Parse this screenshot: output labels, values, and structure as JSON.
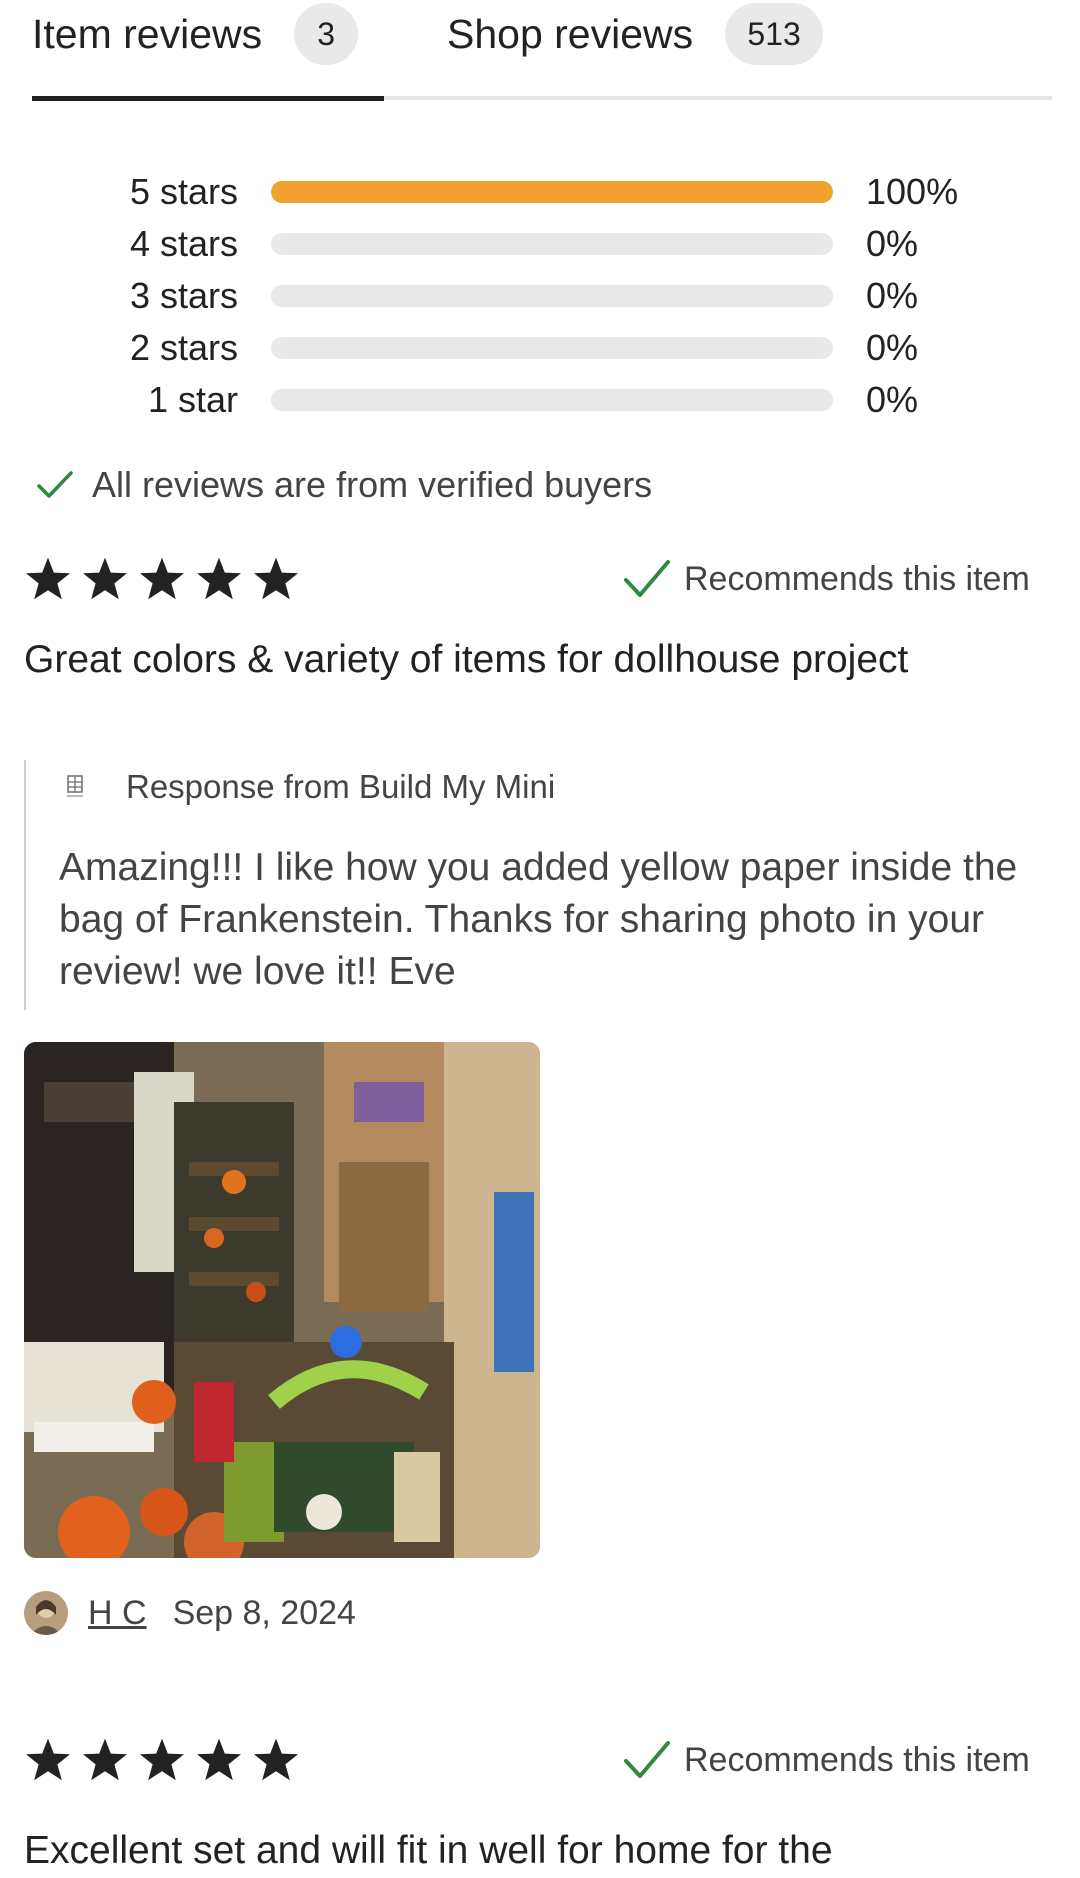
{
  "tabs": [
    {
      "label": "Item reviews",
      "count": "3",
      "active": true
    },
    {
      "label": "Shop reviews",
      "count": "513",
      "active": false
    }
  ],
  "rating_breakdown": [
    {
      "label": "5 stars",
      "percent_text": "100%",
      "fraction": 1.0
    },
    {
      "label": "4 stars",
      "percent_text": "0%",
      "fraction": 0
    },
    {
      "label": "3 stars",
      "percent_text": "0%",
      "fraction": 0
    },
    {
      "label": "2 stars",
      "percent_text": "0%",
      "fraction": 0
    },
    {
      "label": "1 star",
      "percent_text": "0%",
      "fraction": 0
    }
  ],
  "verified_note": "All reviews are from verified buyers",
  "reviews": [
    {
      "rating": 5,
      "recommends": "Recommends this item",
      "title": "Great colors & variety of items for dollhouse project",
      "response_header": "Response from Build My Mini",
      "response_text": "Amazing!!! I like how you added yellow paper inside the bag of Frankenstein. Thanks for sharing photo in your review! we love it!! Eve",
      "author": "H C",
      "date": "Sep 8, 2024"
    },
    {
      "rating": 5,
      "recommends": "Recommends this item",
      "title": "Excellent set and will fit in well for home for the"
    }
  ],
  "colors": {
    "accent_bar": "#f1a02e",
    "check_green": "#2e8a3e",
    "track_gray": "#e9e9e9"
  },
  "icons": {
    "star": "star-icon",
    "check": "checkmark-icon"
  }
}
